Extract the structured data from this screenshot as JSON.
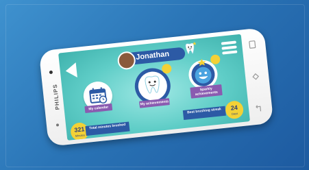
{
  "profile": {
    "name": "Jonathan"
  },
  "tiles": [
    {
      "label": "My calendar",
      "icon": "calendar-icon"
    },
    {
      "label": "My achievements",
      "icon": "tooth-badge-icon"
    },
    {
      "label": "Sparkly achievements",
      "icon": "sparkly-tooth-icon"
    }
  ],
  "stats": {
    "total": {
      "value": "321",
      "unit": "Minutes",
      "label": "Total minutes brushed"
    },
    "streak": {
      "value": "24",
      "unit": "Days",
      "label": "Best brushing streak"
    }
  },
  "device": {
    "brand": "PHILIPS"
  },
  "colors": {
    "screen": "#5fcdc7",
    "pill": "#2c5aa5",
    "ribbon": "#8a5bb0",
    "badge": "#f3d136"
  }
}
